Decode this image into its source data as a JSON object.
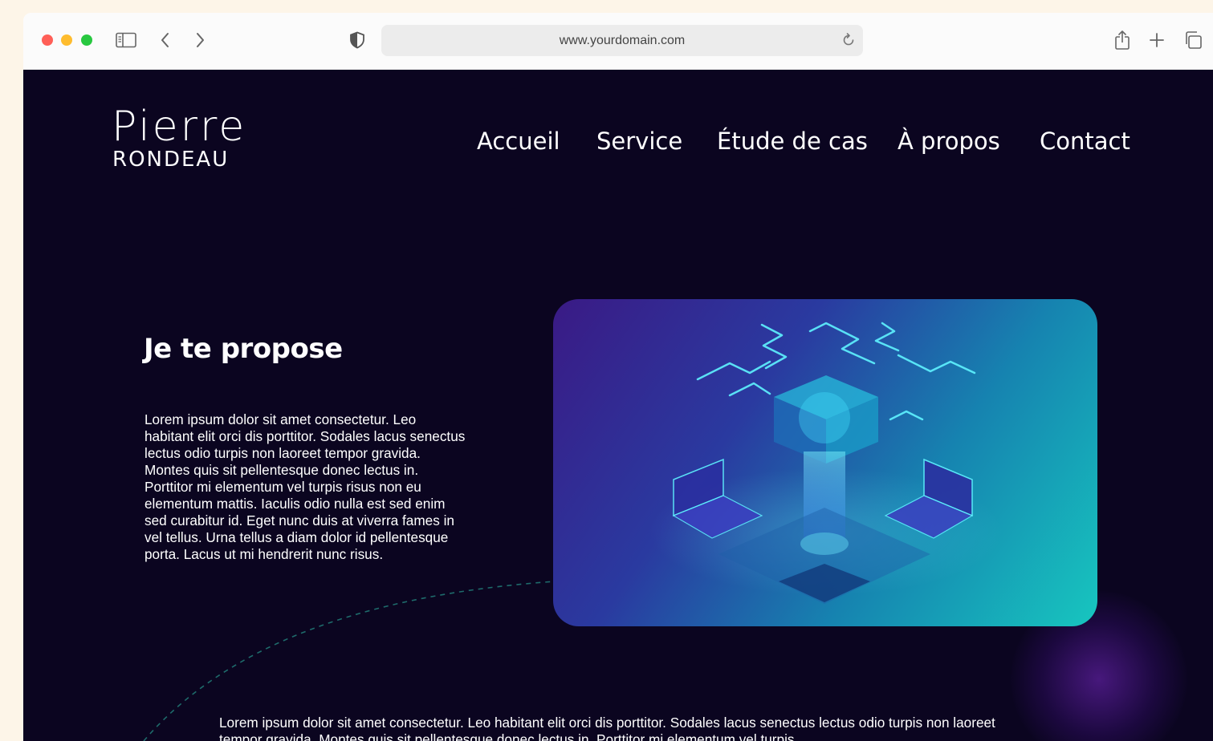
{
  "browser": {
    "url": "www.yourdomain.com",
    "icons": {
      "sidebar": "sidebar-icon",
      "back": "chevron-left-icon",
      "forward": "chevron-right-icon",
      "privacy": "shield-icon",
      "reload": "reload-icon",
      "share": "share-icon",
      "new_tab": "plus-icon",
      "tabs": "tabs-overview-icon"
    },
    "colors": {
      "close": "#ff5f57",
      "minimize": "#febc2e",
      "zoom": "#28c840"
    }
  },
  "site": {
    "logo_top": "Pierre",
    "logo_bottom": "RONDEAU",
    "nav": [
      "Accueil",
      "Service",
      "Étude de cas",
      "À propos",
      "Contact"
    ],
    "headline": "Je te propose",
    "paragraph": "Lorem ipsum dolor sit amet consectetur. Leo habitant elit orci dis porttitor. Sodales lacus senectus lectus odio turpis non laoreet tempor gravida. Montes quis sit pellentesque donec lectus in. Porttitor mi elementum vel turpis risus non eu elementum mattis. Iaculis odio nulla est sed enim sed curabitur id. Eget nunc duis at viverra fames in vel tellus. Urna tellus a diam dolor id pellentesque porta. Lacus ut mi hendrerit nunc risus.",
    "bottom_paragraph": "Lorem ipsum dolor sit amet consectetur. Leo habitant elit orci dis porttitor. Sodales lacus senectus lectus odio turpis non laoreet tempor gravida. Montes quis sit pellentesque donec lectus in. Porttitor mi elementum vel turpis",
    "colors": {
      "background": "#0b0520",
      "text": "#ffffff",
      "accent": "#17c6bf"
    }
  }
}
